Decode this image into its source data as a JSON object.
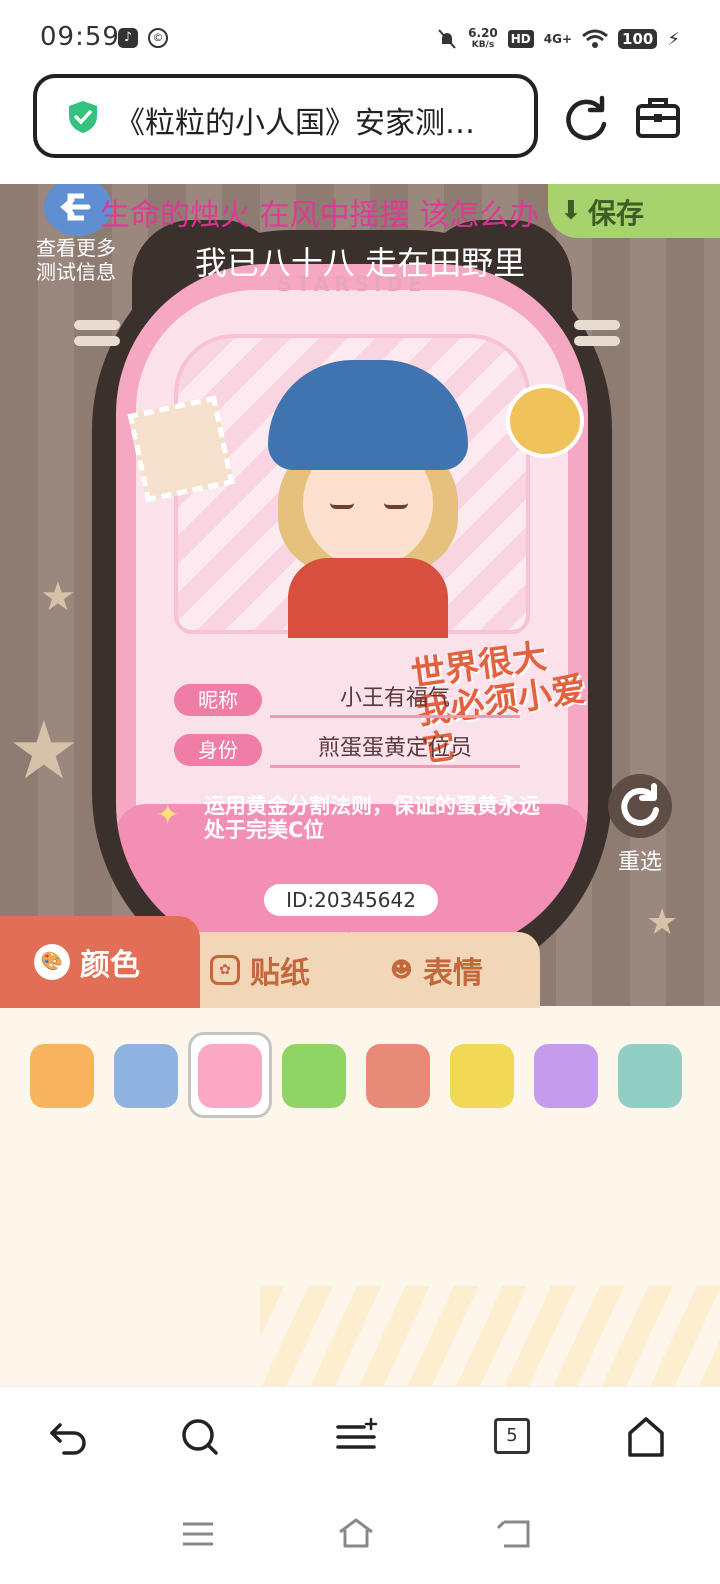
{
  "status_bar": {
    "time": "09:59",
    "speed_value": "6.20",
    "speed_unit": "KB/s",
    "hd_label": "HD",
    "network": "4G+",
    "battery": "100"
  },
  "browser": {
    "url_title": "《粒粒的小人国》安家测…",
    "tab_count": "5"
  },
  "stage": {
    "lyric_top": "生命的烛火 在风中摇摆 该怎么办",
    "lyric_bottom": "我已八十八 走在田野里",
    "more_info_label": "查看更多\n测试信息",
    "save_label": "保存",
    "reroll_label": "重选"
  },
  "card": {
    "brand": "STARSIDE",
    "slogan_line1": "世界很大",
    "slogan_line2": "我必须小爱它",
    "nickname_tag": "昵称",
    "nickname_value": "小王有福气",
    "identity_tag": "身份",
    "identity_value": "煎蛋蛋黄定位员",
    "description": "运用黄金分割法则，保证的蛋黄永远处于完美C位",
    "id_text": "ID:20345642"
  },
  "tabs": {
    "color_label": "颜色",
    "sticker_label": "贴纸",
    "emote_label": "表情"
  },
  "swatches": {
    "colors": [
      "#f7b45f",
      "#8fb2e1",
      "#fba8c4",
      "#91d466",
      "#e88a78",
      "#f0da55",
      "#c59cec",
      "#91cfc5"
    ],
    "selected_index": 2
  },
  "colors": {
    "accent_tab": "#e16e55",
    "card_pink": "#f6a8c3"
  }
}
